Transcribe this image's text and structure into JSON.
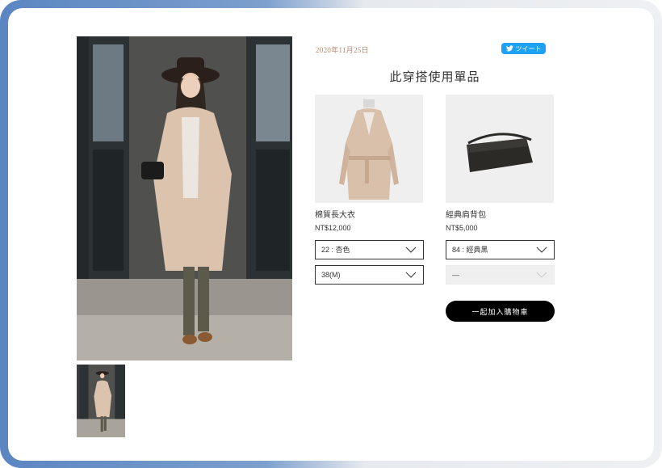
{
  "post": {
    "date": "2020年11月25日",
    "tweet_label": "ツイート"
  },
  "section_title": "此穿搭使用單品",
  "products": [
    {
      "name": "棉質長大衣",
      "price": "NT$12,000",
      "option1": "22 : 杏色",
      "option2": "38(M)"
    },
    {
      "name": "經典肩背包",
      "price": "NT$5,000",
      "option1": "84 : 經典黑",
      "option2": "—"
    }
  ],
  "cart_button": "一起加入購物車",
  "colors": {
    "tweet": "#1da1f2",
    "date": "#b0896f",
    "button": "#000000"
  }
}
